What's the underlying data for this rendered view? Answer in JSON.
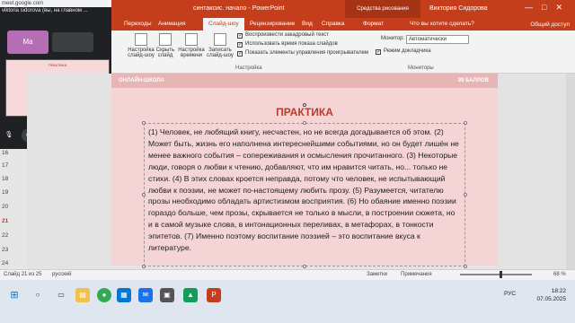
{
  "window": {
    "title": "синтаксис. начало  -  PowerPoint",
    "tools_label": "Средства рисования",
    "user": "Виктория Сидорова",
    "controls": [
      "—",
      "□",
      "✕"
    ]
  },
  "ribbon_tabs": [
    "Переходы",
    "Анимация",
    "Слайд-шоу",
    "Рецензирование",
    "Вид",
    "Справка",
    "Формат",
    "Что вы хотите сделать?"
  ],
  "ribbon_active_tab": "Слайд-шоу",
  "ribbon": {
    "buttons": [
      {
        "label": "Настройка слайд-шоу"
      },
      {
        "label": "Скрыть слайд"
      },
      {
        "label": "Настройка времени"
      },
      {
        "label": "Записать слайд-шоу"
      }
    ],
    "checkboxes": [
      {
        "label": "Воспроизвести закадровый текст",
        "checked": true
      },
      {
        "label": "Использовать время показа слайдов",
        "checked": true
      },
      {
        "label": "Показать элементы управления проигрывателем",
        "checked": true
      }
    ],
    "group_setup": "Настройка",
    "monitor_label": "Монитор:",
    "monitor_value": "Автоматически",
    "presenter_view": "Режим докладчика",
    "group_monitors": "Мониторы",
    "share": "Общий доступ"
  },
  "meet": {
    "url": "meet.google.com",
    "caption": "viktoria sidorova (вы, на главном ...",
    "tile_name": "Ma",
    "share_title": "ПРАКТИКА"
  },
  "thumbnails": [
    "16",
    "17",
    "18",
    "19",
    "20",
    "21",
    "22",
    "23",
    "24"
  ],
  "current_slide_number": "21",
  "slide": {
    "header_left": "ОНЛАЙН-ШКОЛА",
    "header_right": "99 БАЛЛОВ",
    "title": "ПРАКТИКА",
    "body": "(1) Человек, не любящий книгу, несчастен, но не всегда догадывается об этом. (2) Может быть, жизнь его наполнена интереснейшими событиями, но он будет лишён не менее важного события – сопереживания и осмысления прочитанного. (3) Некоторые люди, говоря о любви к чтению, добавляют, что им нравится читать, но... только не стихи. (4) В этих словах кроется неправда, потому что человек, не испытывающий любви к поэзии, не может по-настоящему любить прозу. (5) Разумеется, читателю прозы необходимо обладать артистизмом восприятия. (6) Но обаяние именно поэзии гораздо больше, чем прозы, скрывается не только в мысли, в построении сюжета, но и в самой музыке слова, в интонационных переливах, в метафорах, в тонкости эпитетов. (7) Именно поэтому воспитание поэзией – это воспитание вкуса к литературе."
  },
  "statusbar": {
    "slide_info": "Слайд 21 из 25",
    "language": "русский",
    "notes": "Заметки",
    "comments": "Примечания",
    "zoom": "68 %"
  },
  "tray": {
    "lang": "РУС",
    "time": "18:22",
    "date": "07.05.2025"
  }
}
